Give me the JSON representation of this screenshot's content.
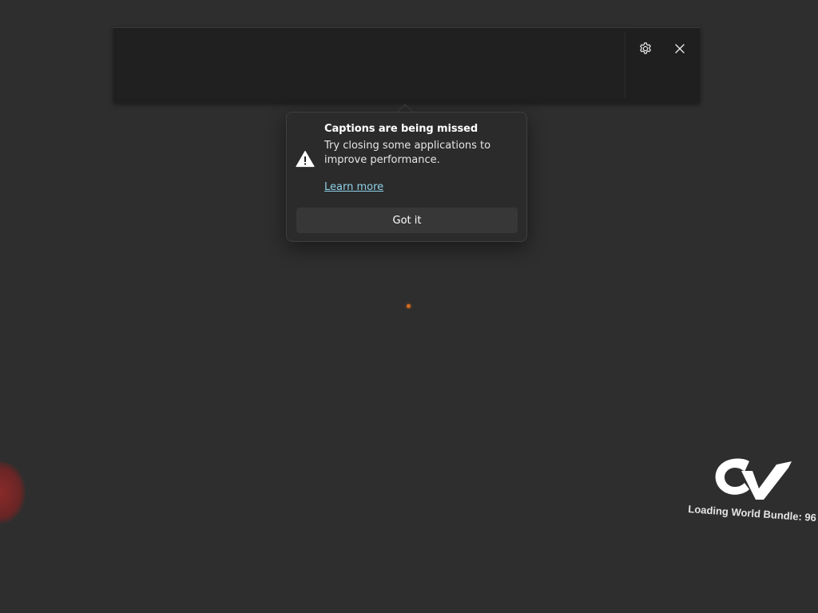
{
  "caption_window": {
    "settings_icon": "gear-icon",
    "close_icon": "close-icon"
  },
  "teaching_tip": {
    "icon": "warning-icon",
    "title": "Captions are being missed",
    "body": "Try closing some applications to improve performance.",
    "link": "Learn more",
    "button": "Got it"
  },
  "background": {
    "loading_text": "Loading World Bundle: 96",
    "logo": "cvr-logo-icon"
  },
  "colors": {
    "background": "#2e2e2e",
    "caption_bar": "#1f1f1f",
    "tip_background": "#2b2b2b",
    "link": "#8fd0e8",
    "button": "#373737",
    "dot": "#d2691e"
  }
}
